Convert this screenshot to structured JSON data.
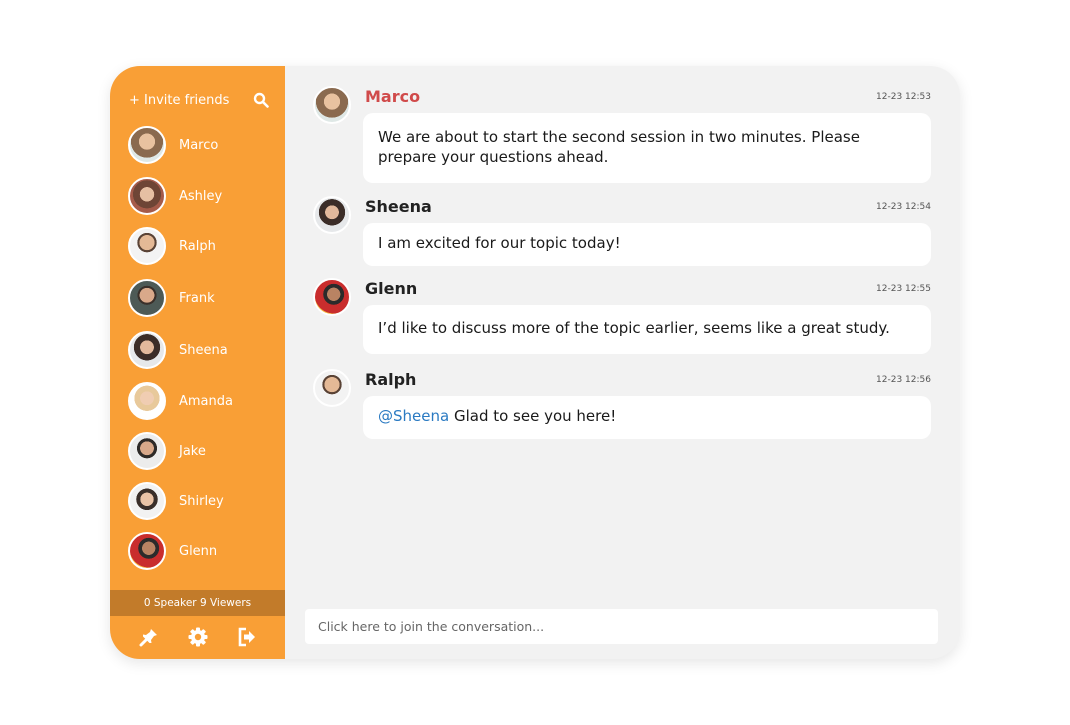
{
  "sidebar": {
    "invite_label": "+ Invite friends",
    "search_icon": "search-icon",
    "people": [
      {
        "name": "Marco",
        "avatar_color": "#8a6a4f"
      },
      {
        "name": "Ashley",
        "avatar_color": "#a55b4a"
      },
      {
        "name": "Ralph",
        "avatar_color": "#d9b89a"
      },
      {
        "name": "Frank",
        "avatar_color": "#4d5a56"
      },
      {
        "name": "Sheena",
        "avatar_color": "#3b2d28"
      },
      {
        "name": "Amanda",
        "avatar_color": "#e8c99b"
      },
      {
        "name": "Jake",
        "avatar_color": "#2e2a28"
      },
      {
        "name": "Shirley",
        "avatar_color": "#3a2f2a"
      },
      {
        "name": "Glenn",
        "avatar_color": "#c92d2d"
      }
    ],
    "stats": "0 Speaker 9 Viewers",
    "bottom_icons": [
      "pin-icon",
      "gear-icon",
      "exit-icon"
    ]
  },
  "messages": [
    {
      "author": "Marco",
      "time": "12-23 12:53",
      "text": "We are about to start the second session in two minutes. Please prepare your questions ahead.",
      "author_color": "#d04a4a",
      "avatar_color": "#8a6a4f"
    },
    {
      "author": "Sheena",
      "time": "12-23 12:54",
      "text": "I am excited for our topic today!",
      "avatar_color": "#3b2d28"
    },
    {
      "author": "Glenn",
      "time": "12-23 12:55",
      "text": "I’d like to discuss more of the topic earlier, seems like a great study.",
      "avatar_color": "#c92d2d"
    },
    {
      "author": "Ralph",
      "time": "12-23 12:56",
      "mention": "@Sheena",
      "text": " Glad to see you here!",
      "avatar_color": "#d9b89a"
    }
  ],
  "composer": {
    "placeholder": "Click here to join the conversation..."
  },
  "colors": {
    "sidebar": "#f99f36",
    "stats_bar": "#c27b2a",
    "mention": "#2a7ac2",
    "highlight_author": "#d04a4a"
  }
}
